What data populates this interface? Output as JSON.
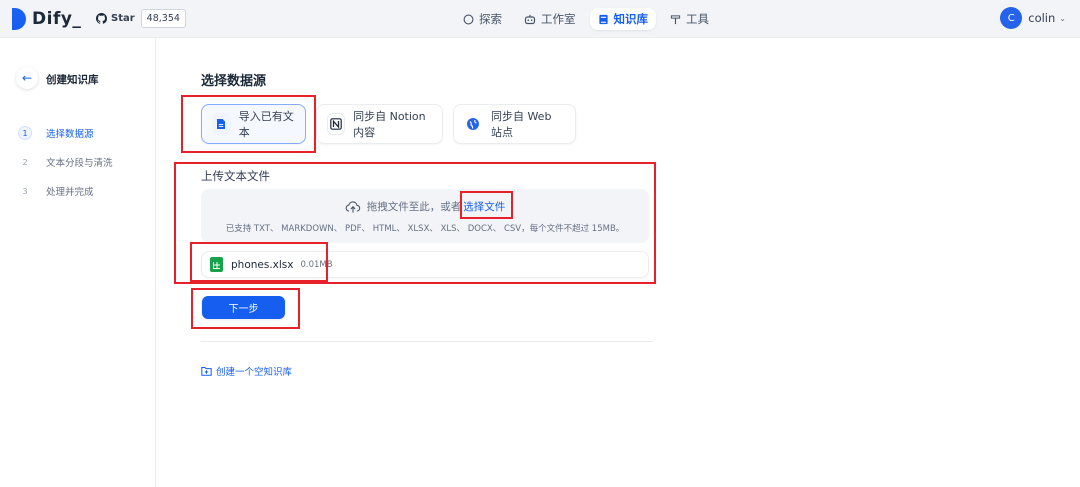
{
  "header": {
    "logo_text": "Dify_",
    "github": {
      "star_label": "Star",
      "star_count": "48,354"
    },
    "nav": [
      {
        "label": "探索",
        "icon": "compass-icon",
        "active": false
      },
      {
        "label": "工作室",
        "icon": "robot-icon",
        "active": false
      },
      {
        "label": "知识库",
        "icon": "book-icon",
        "active": true
      },
      {
        "label": "工具",
        "icon": "hammer-icon",
        "active": false
      }
    ],
    "user": {
      "avatar_letter": "C",
      "name": "colin"
    }
  },
  "sidebar": {
    "title": "创建知识库",
    "steps": [
      {
        "num": "1",
        "label": "选择数据源",
        "active": true
      },
      {
        "num": "2",
        "label": "文本分段与清洗",
        "active": false
      },
      {
        "num": "3",
        "label": "处理并完成",
        "active": false
      }
    ]
  },
  "main": {
    "title": "选择数据源",
    "sources": [
      {
        "label": "导入已有文本",
        "icon": "document-icon",
        "active": true
      },
      {
        "label": "同步自 Notion 内容",
        "icon": "notion-icon",
        "active": false
      },
      {
        "label": "同步自 Web 站点",
        "icon": "globe-icon",
        "active": false
      }
    ],
    "upload": {
      "label": "上传文本文件",
      "drag_text": "拖拽文件至此，或者",
      "select_link": "选择文件",
      "support_text": "已支持 TXT、 MARKDOWN、 PDF、 HTML、 XLSX、 XLS、 DOCX、 CSV，每个文件不超过 15MB。"
    },
    "file": {
      "name": "phones.xlsx",
      "size": "0.01MB"
    },
    "next_button": "下一步",
    "create_empty": "创建一个空知识库"
  },
  "colors": {
    "accent": "#155eef",
    "annotation": "#e8202a",
    "excel": "#16a34a"
  }
}
